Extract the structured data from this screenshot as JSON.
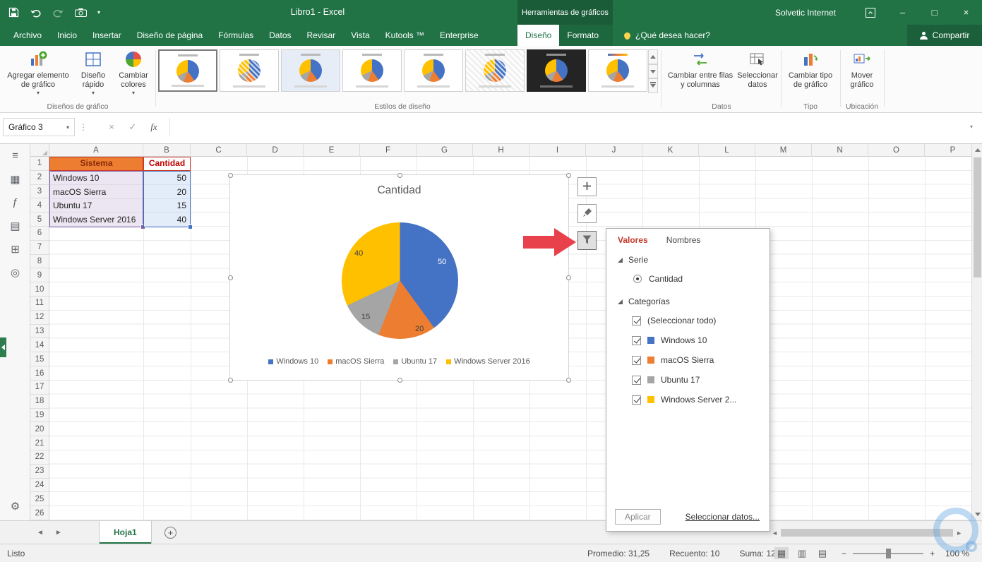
{
  "titlebar": {
    "title": "Libro1 - Excel",
    "contextual_label": "Herramientas de gráficos",
    "user": "Solvetic Internet"
  },
  "ribbon": {
    "tabs": [
      "Archivo",
      "Inicio",
      "Insertar",
      "Diseño de página",
      "Fórmulas",
      "Datos",
      "Revisar",
      "Vista",
      "Kutools ™",
      "Enterprise"
    ],
    "contextual_tabs": [
      "Diseño",
      "Formato"
    ],
    "active_tab": "Diseño",
    "search_placeholder": "¿Qué desea hacer?",
    "share_label": "Compartir",
    "groups": [
      {
        "label": "Diseños de gráfico",
        "buttons": [
          {
            "label": "Agregar elemento de gráfico",
            "dropdown": true
          },
          {
            "label": "Diseño rápido",
            "dropdown": true
          },
          {
            "label": "Cambiar colores",
            "dropdown": true
          }
        ]
      },
      {
        "label": "Estilos de diseño"
      },
      {
        "label": "Datos",
        "buttons": [
          {
            "label": "Cambiar entre filas y columnas"
          },
          {
            "label": "Seleccionar datos"
          }
        ]
      },
      {
        "label": "Tipo",
        "buttons": [
          {
            "label": "Cambiar tipo de gráfico"
          }
        ]
      },
      {
        "label": "Ubicación",
        "buttons": [
          {
            "label": "Mover gráfico"
          }
        ]
      }
    ]
  },
  "formula_bar": {
    "name_box": "Gráfico 3",
    "formula": ""
  },
  "grid": {
    "columns": [
      "A",
      "B",
      "C",
      "D",
      "E",
      "F",
      "G",
      "H",
      "I",
      "J",
      "K",
      "L",
      "M",
      "N",
      "O",
      "P"
    ],
    "row_count": 26,
    "table": {
      "headers": [
        "Sistema",
        "Cantidad"
      ],
      "rows": [
        [
          "Windows 10",
          "50"
        ],
        [
          "macOS Sierra",
          "20"
        ],
        [
          "Ubuntu 17",
          "15"
        ],
        [
          "Windows Server 2016",
          "40"
        ]
      ]
    }
  },
  "chart_data": {
    "type": "pie",
    "title": "Cantidad",
    "categories": [
      "Windows 10",
      "macOS Sierra",
      "Ubuntu 17",
      "Windows Server 2016"
    ],
    "values": [
      50,
      20,
      15,
      40
    ],
    "colors": [
      "#4472C4",
      "#ED7D31",
      "#A5A5A5",
      "#FFC000"
    ],
    "legend_position": "bottom",
    "data_labels_visible": true
  },
  "filter_panel": {
    "tabs": [
      "Valores",
      "Nombres"
    ],
    "active_tab": "Valores",
    "serie_label": "Serie",
    "serie_option": "Cantidad",
    "categories_label": "Categorías",
    "options": [
      {
        "label": "(Seleccionar todo)",
        "checked": true,
        "color": null
      },
      {
        "label": "Windows 10",
        "checked": true,
        "color": "#4472C4"
      },
      {
        "label": "macOS Sierra",
        "checked": true,
        "color": "#ED7D31"
      },
      {
        "label": "Ubuntu 17",
        "checked": true,
        "color": "#A5A5A5"
      },
      {
        "label": "Windows Server 2...",
        "checked": true,
        "color": "#FFC000"
      }
    ],
    "apply_label": "Aplicar",
    "select_data_label": "Seleccionar datos..."
  },
  "left_toolbar": {
    "items": [
      {
        "name": "menu",
        "glyph": "≡"
      },
      {
        "name": "workbook-grid",
        "glyph": "▦"
      },
      {
        "name": "formula",
        "glyph": "ƒ"
      },
      {
        "name": "layers",
        "glyph": "▤"
      },
      {
        "name": "grid-view",
        "glyph": "⊞"
      },
      {
        "name": "find",
        "glyph": "◎"
      }
    ]
  },
  "sheetbar": {
    "tabs": [
      "Hoja1"
    ],
    "active_tab": "Hoja1"
  },
  "status_bar": {
    "mode": "Listo",
    "average": "Promedio: 31,25",
    "count": "Recuento: 10",
    "sum": "Suma: 125",
    "zoom_percent": "100 %"
  },
  "icons": {
    "dropdown": "▾",
    "dots": "⋮",
    "formula_cancel": "×",
    "formula_enter": "✓",
    "fx_label": "fx",
    "sheet_prev": "◄",
    "sheet_next": "►",
    "new_sheet": "+",
    "minimize": "–",
    "maximize": "□",
    "close": "×",
    "gear": "⚙",
    "zoom_out": "−",
    "zoom_in": "+",
    "view_normal": "▦",
    "view_layout": "▥",
    "view_break": "▤"
  },
  "colors": {
    "app_green": "#217346",
    "category_border": "#7c5fa8",
    "value_border": "#4472C4",
    "header_fill": "#ED7D31",
    "arrow_red": "#e8414c"
  }
}
